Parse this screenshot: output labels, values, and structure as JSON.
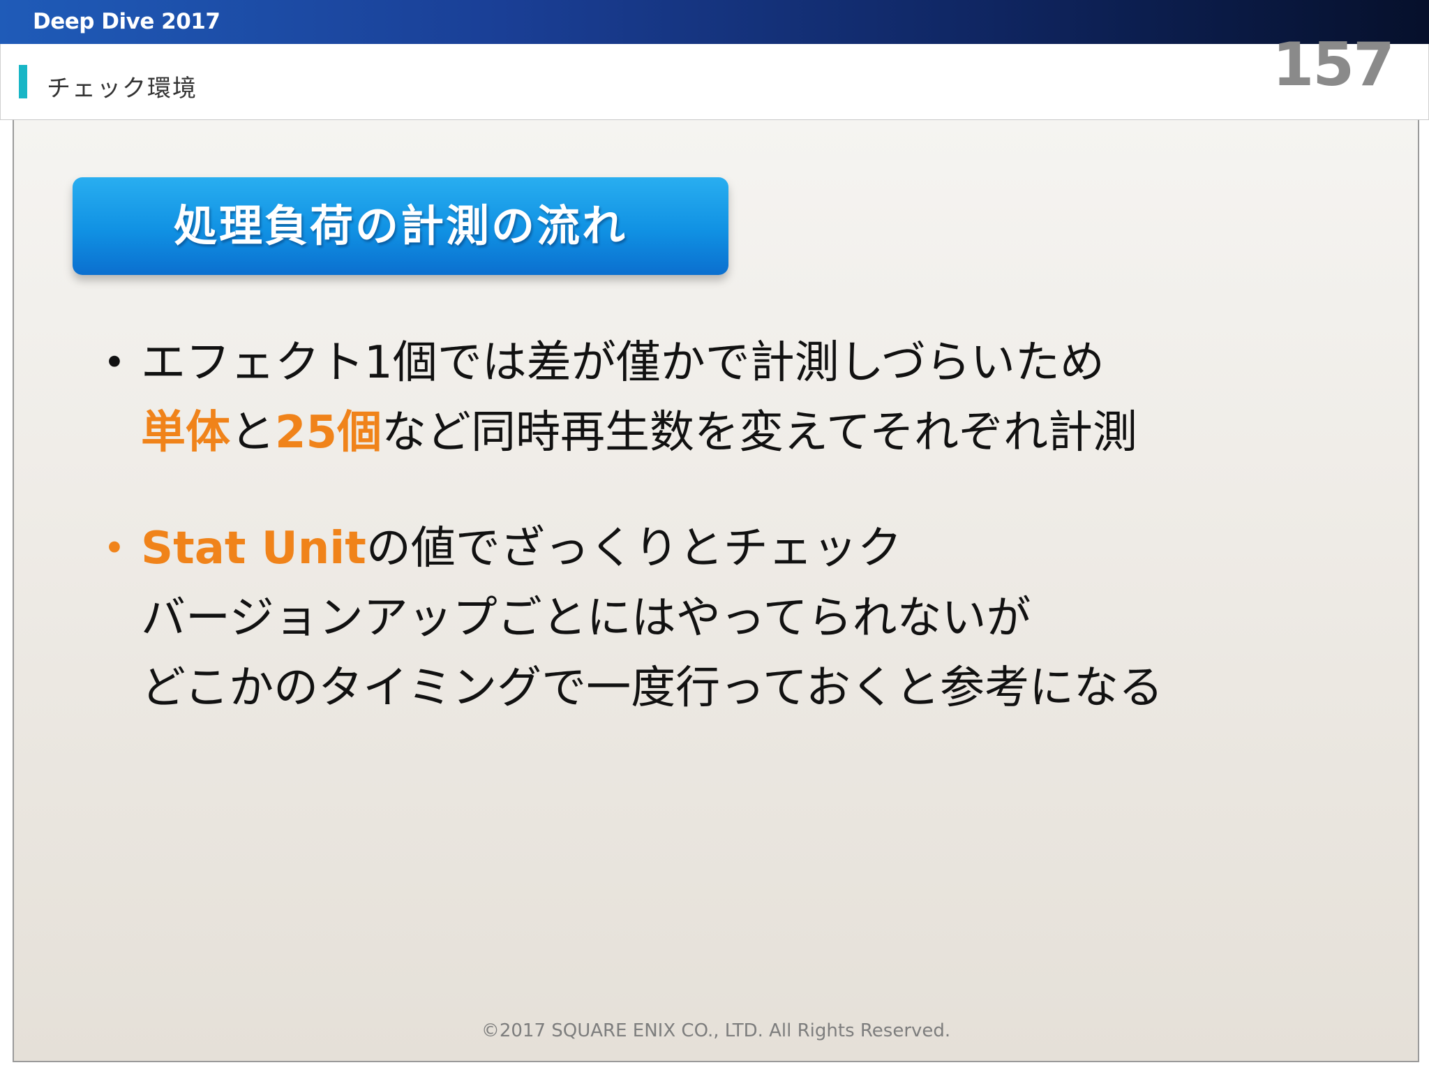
{
  "header": {
    "brand": "Deep Dive 2017",
    "section_title": "チェック環境",
    "page_number": "157"
  },
  "slide": {
    "heading": "処理負荷の計測の流れ",
    "bullets": [
      {
        "line1": "エフェクト1個では差が僅かで計測しづらいため",
        "line2": {
          "hl1": "単体",
          "text1": "と",
          "hl2": "25個",
          "text2": "など同時再生数を変えてそれぞれ計測"
        }
      },
      {
        "line1": {
          "hl": "Stat Unit",
          "text": "の値でざっくりとチェック"
        },
        "line2": "バージョンアップごとにはやってられないが",
        "line3": "どこかのタイミングで一度行っておくと参考になる"
      }
    ],
    "footer": "©2017 SQUARE ENIX CO., LTD. All Rights Reserved."
  },
  "colors": {
    "accent_orange": "#f0831a",
    "pill_blue": "#1091e3",
    "marker_teal": "#18b6c6",
    "topbar_blue": "#1a3f96"
  }
}
